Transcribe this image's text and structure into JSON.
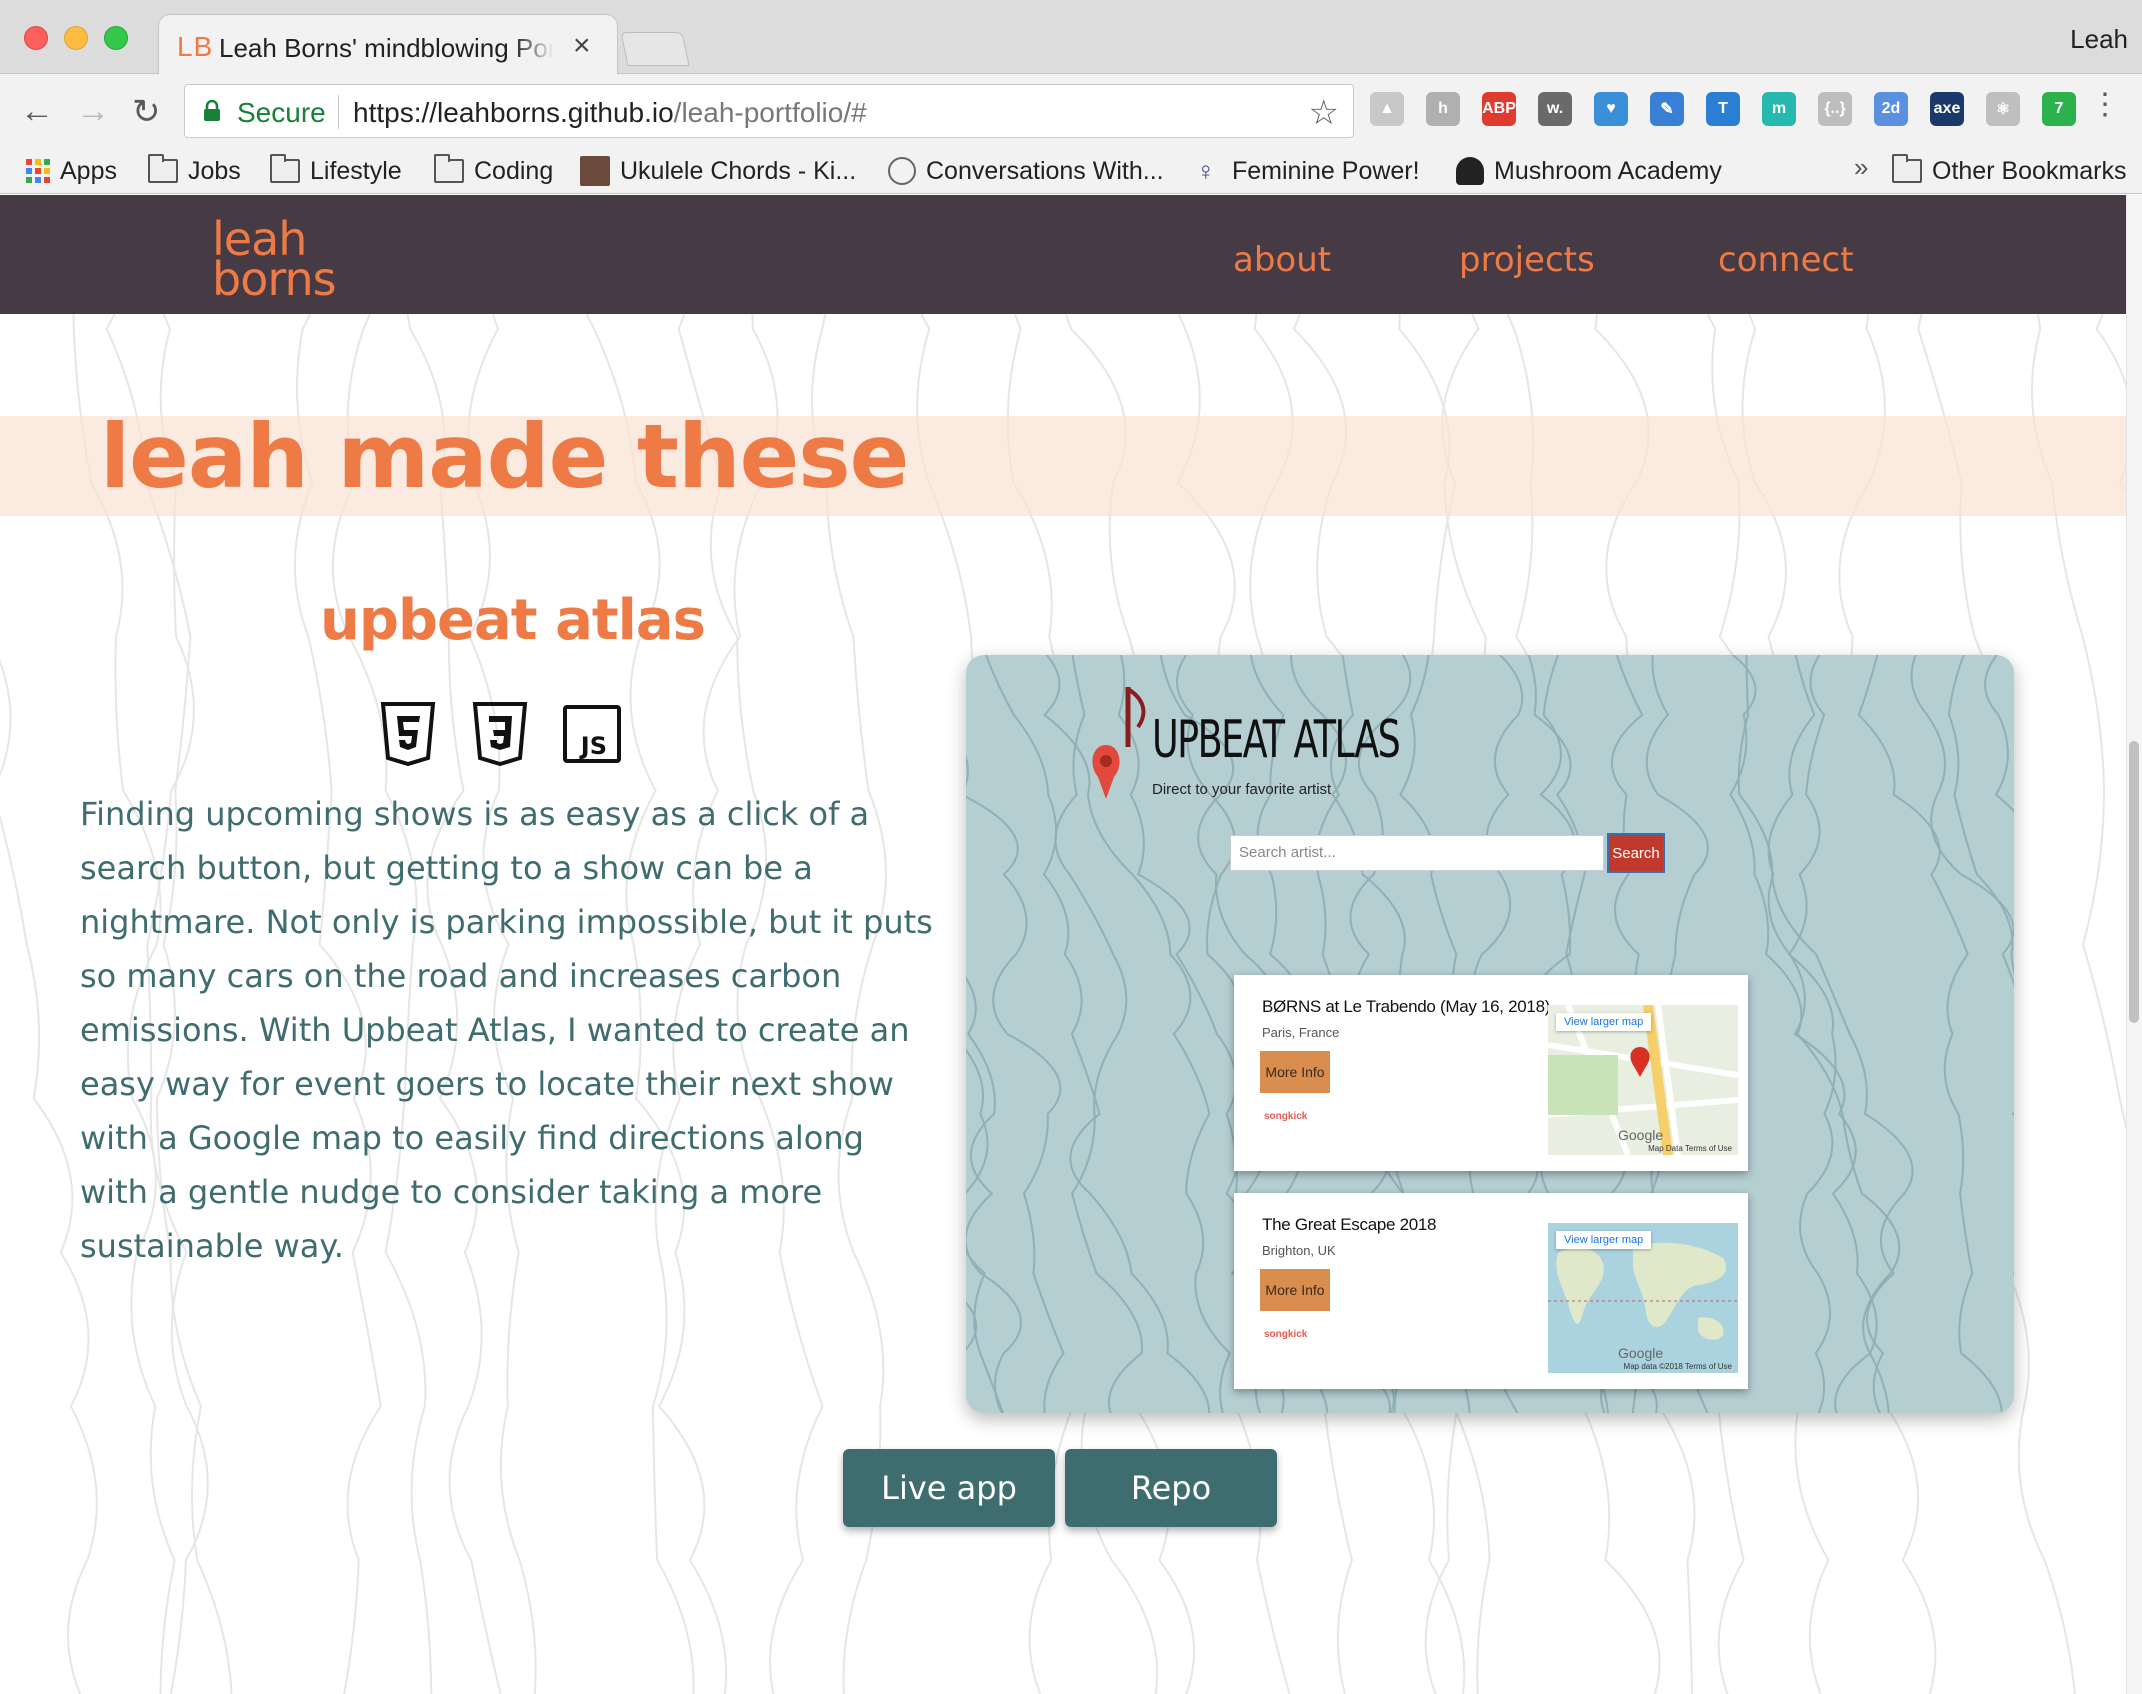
{
  "browser": {
    "tab_favicon": "LB",
    "tab_title": "Leah Borns' mindblowing Portfolio",
    "tab_close": "×",
    "profile_name": "Leah",
    "secure_label": "Secure",
    "url_host": "https://leahborns.github.io",
    "url_path": "/leah-portfolio/#",
    "back_icon": "←",
    "forward_icon": "→",
    "reload_icon": "↻",
    "star_icon": "☆",
    "menu_icon": "⋮",
    "extensions": [
      {
        "name": "drive-icon",
        "label": "▲",
        "color": "#c8c8c8"
      },
      {
        "name": "hypothesis-icon",
        "label": "h",
        "color": "#b0b0b0"
      },
      {
        "name": "adblock-icon",
        "label": "ABP",
        "color": "#e03b2f"
      },
      {
        "name": "wordtune-icon",
        "label": "w.",
        "color": "#6a6a6a"
      },
      {
        "name": "pocket-icon",
        "label": "♥",
        "color": "#3a8fd9"
      },
      {
        "name": "eyedropper-icon",
        "label": "✎",
        "color": "#3a7fd6"
      },
      {
        "name": "t-icon",
        "label": "T",
        "color": "#2a7fd4"
      },
      {
        "name": "m-icon",
        "label": "m",
        "color": "#27b8b0"
      },
      {
        "name": "json-icon",
        "label": "{..}",
        "color": "#bdbdbd"
      },
      {
        "name": "calendar-icon",
        "label": "2d",
        "color": "#5b8fe0"
      },
      {
        "name": "axe-icon",
        "label": "axe",
        "color": "#1b3a6b"
      },
      {
        "name": "react-icon",
        "label": "⚛",
        "color": "#bfbfbf"
      },
      {
        "name": "badge-icon",
        "label": "7",
        "color": "#2bb24c"
      }
    ]
  },
  "bookmarks": {
    "items": [
      {
        "label": "Apps",
        "kind": "apps"
      },
      {
        "label": "Jobs",
        "kind": "folder"
      },
      {
        "label": "Lifestyle",
        "kind": "folder"
      },
      {
        "label": "Coding",
        "kind": "folder"
      },
      {
        "label": "Ukulele Chords - Ki...",
        "kind": "page"
      },
      {
        "label": "Conversations With...",
        "kind": "page"
      },
      {
        "label": "Feminine Power!",
        "kind": "page"
      },
      {
        "label": "Mushroom Academy",
        "kind": "page"
      }
    ],
    "more": "»",
    "other": "Other Bookmarks"
  },
  "site": {
    "logo_line1": "leah",
    "logo_line2": "borns",
    "nav": [
      "about",
      "projects",
      "connect"
    ],
    "section_heading": "leah made these",
    "project": {
      "title": "upbeat atlas",
      "tech": [
        "html5-icon",
        "css3-icon",
        "javascript-icon"
      ],
      "tech_js_label": "JS",
      "description": "Finding upcoming shows is as easy as a click of a search button, but getting to a show can be a nightmare. Not only is parking impossible, but it puts so many cars on the road and increases carbon emissions. With Upbeat Atlas, I wanted to create an easy way for event goers to locate their next show with a Google map to easily find directions along with a gentle nudge to consider taking a more sustainable way.",
      "buttons": {
        "live": "Live app",
        "repo": "Repo"
      }
    },
    "preview": {
      "app_title": "UPBEAT ATLAS",
      "tagline": "Direct to your favorite artist",
      "search_placeholder": "Search artist...",
      "search_button": "Search",
      "cards": [
        {
          "title": "BØRNS at Le Trabendo (May 16, 2018)",
          "location": "Paris, France",
          "more_label": "More Info",
          "songkick": "songkick",
          "map_button": "View larger map",
          "map_google": "Google",
          "map_data": "Map Data   Terms of Use"
        },
        {
          "title": "The Great Escape 2018",
          "location": "Brighton, UK",
          "more_label": "More Info",
          "songkick": "songkick",
          "map_button": "View larger map",
          "map_google": "Google",
          "map_data": "Map data ©2018   Terms of Use"
        }
      ]
    }
  },
  "colors": {
    "accent": "#ee7a45",
    "nav_bg": "#463a44",
    "teal_text": "#3f6d6f",
    "button_bg": "#3e6d70"
  }
}
